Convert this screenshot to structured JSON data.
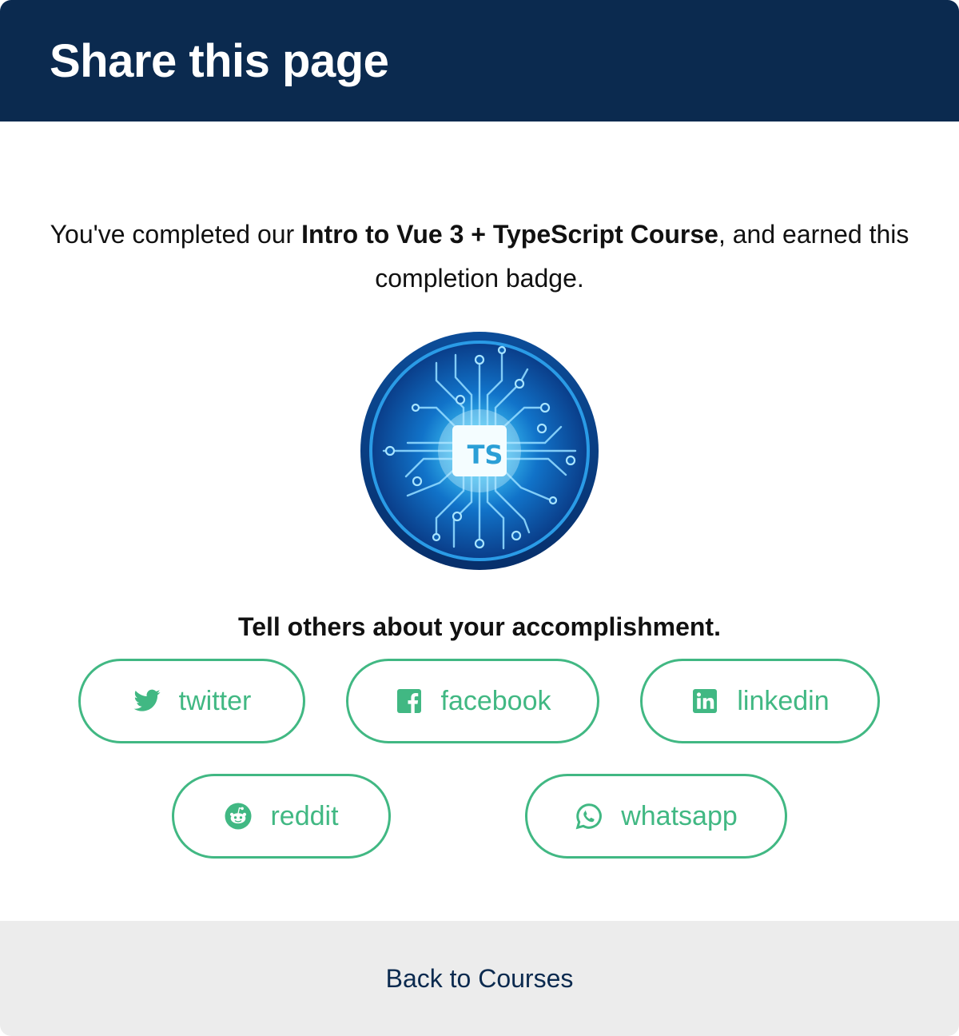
{
  "modal": {
    "title": "Share this page",
    "intro": {
      "before": "You've completed our ",
      "course_name": "Intro to Vue 3 + TypeScript Course",
      "after": ", and earned this completion badge."
    },
    "badge": {
      "icon": "typescript-circuit-badge-icon",
      "label": "TS"
    },
    "cta": "Tell others about your accomplishment.",
    "share_buttons": [
      {
        "label": "twitter",
        "icon": "twitter-icon"
      },
      {
        "label": "facebook",
        "icon": "facebook-icon"
      },
      {
        "label": "linkedin",
        "icon": "linkedin-icon"
      },
      {
        "label": "reddit",
        "icon": "reddit-icon"
      },
      {
        "label": "whatsapp",
        "icon": "whatsapp-icon"
      }
    ],
    "footer_link": "Back to Courses"
  },
  "colors": {
    "header_bg": "#0b2a4f",
    "accent_green": "#41b883",
    "footer_bg": "#ececec",
    "link_navy": "#0b2a4f"
  }
}
